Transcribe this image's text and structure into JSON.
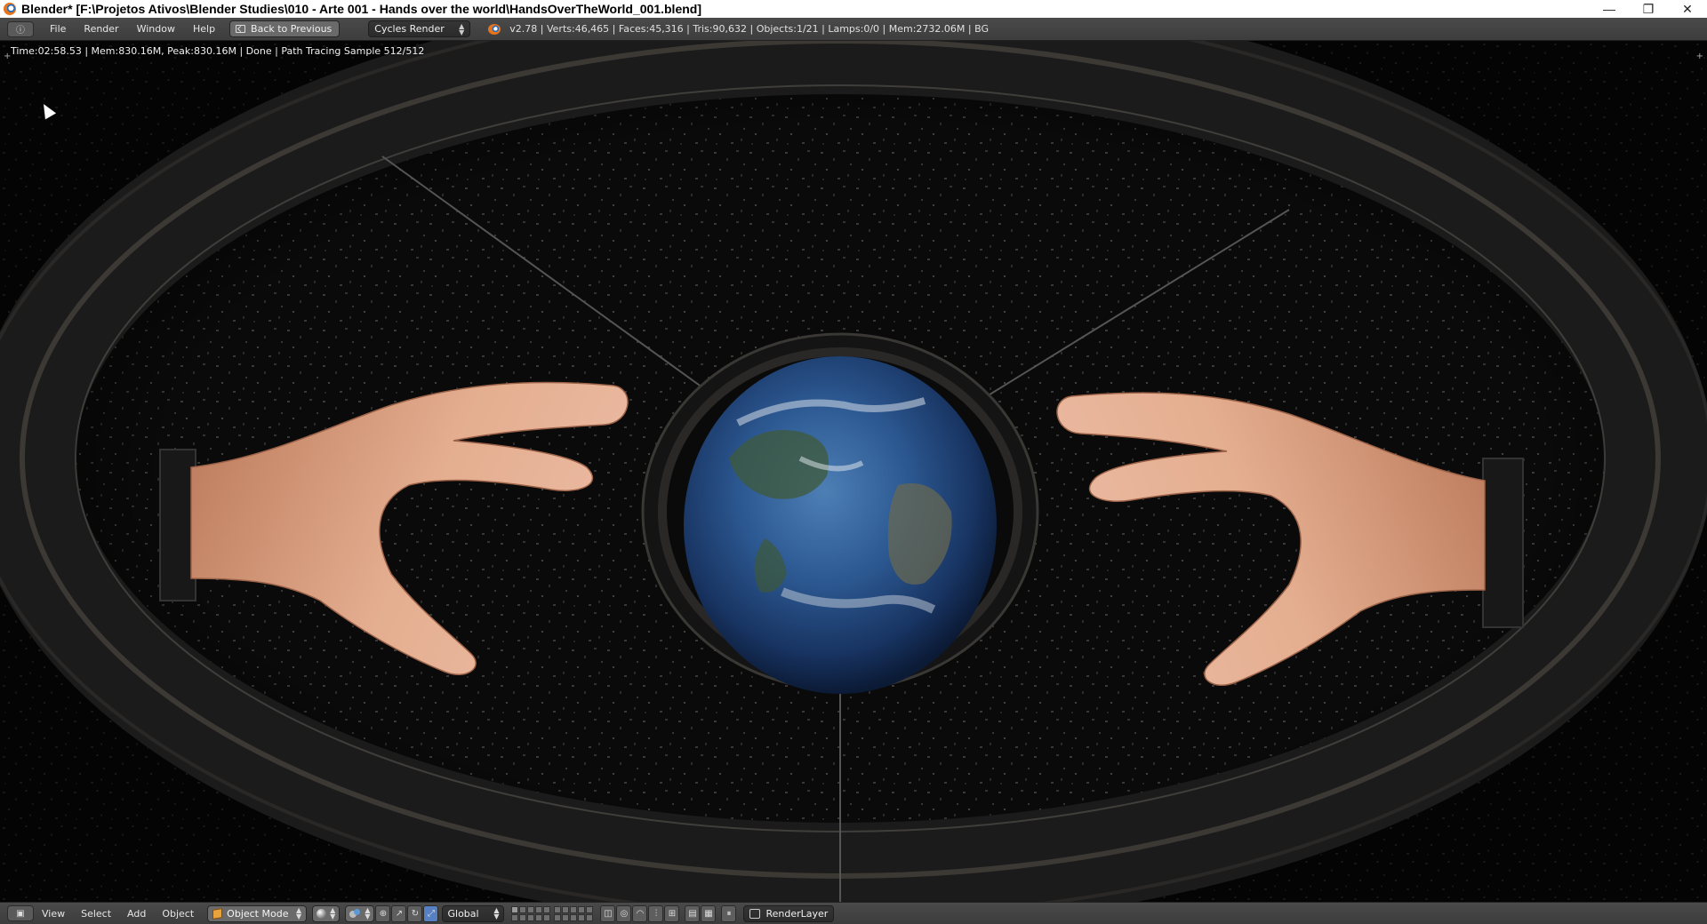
{
  "window": {
    "title": "Blender* [F:\\Projetos Ativos\\Blender Studies\\010 - Arte 001 - Hands over the world\\HandsOverTheWorld_001.blend]",
    "controls": {
      "minimize": "—",
      "restore": "❐",
      "close": "✕"
    }
  },
  "info_header": {
    "menus": [
      "File",
      "Render",
      "Window",
      "Help"
    ],
    "back_button": "Back to Previous",
    "render_engine": "Cycles Render",
    "stats": "v2.78 | Verts:46,465 | Faces:45,316 | Tris:90,632 | Objects:1/21 | Lamps:0/0 | Mem:2732.06M | BG"
  },
  "viewport": {
    "render_status": "Time:02:58.53 | Mem:830.16M, Peak:830.16M | Done | Path Tracing Sample 512/512"
  },
  "view3d_header": {
    "menus": [
      "View",
      "Select",
      "Add",
      "Object"
    ],
    "mode": "Object Mode",
    "orientation": "Global",
    "render_layer": "RenderLayer"
  },
  "colors": {
    "header_bg": "#434343",
    "accent": "#5680c2",
    "skin": "#e0a889",
    "earth_ocean": "#1e3d6b"
  }
}
